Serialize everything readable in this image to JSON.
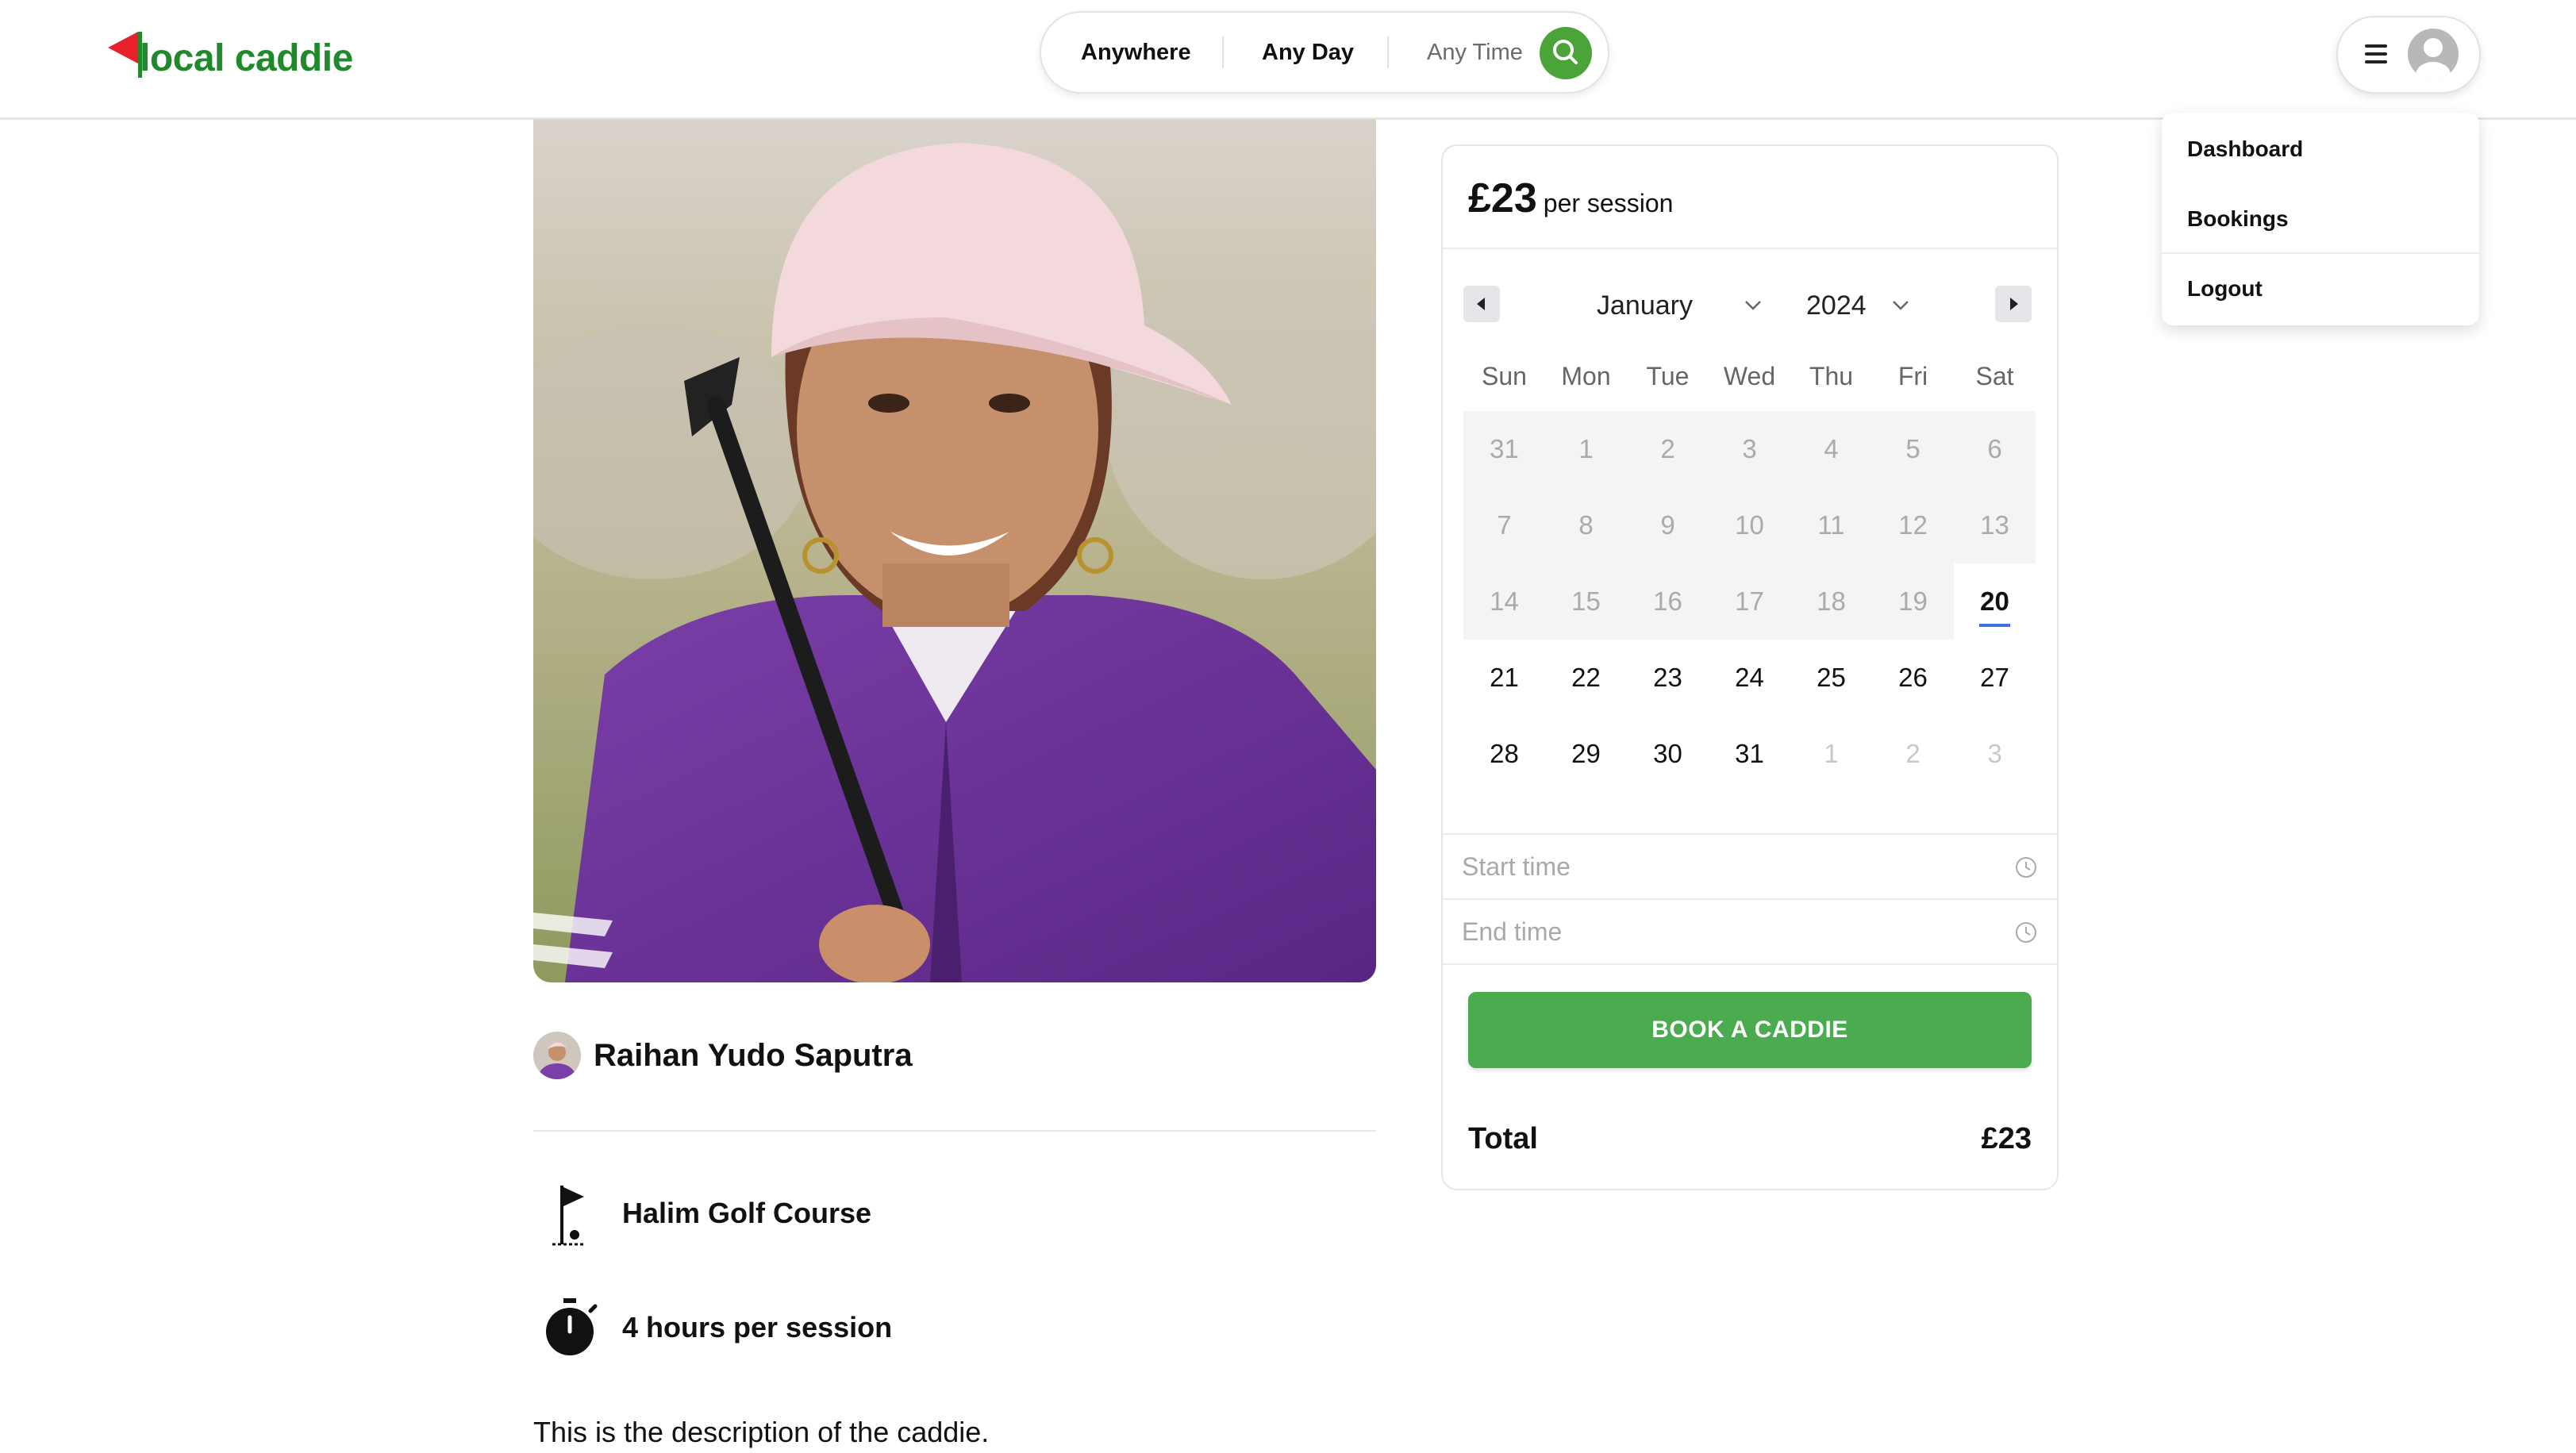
{
  "header": {
    "logo_text": "local caddie",
    "search": {
      "location": "Anywhere",
      "day": "Any Day",
      "time": "Any Time"
    }
  },
  "user_menu": {
    "items": [
      {
        "label": "Dashboard"
      },
      {
        "label": "Bookings"
      },
      {
        "label": "Logout"
      }
    ]
  },
  "caddie": {
    "name": "Raihan Yudo Saputra",
    "course": "Halim Golf Course",
    "duration": "4 hours per session",
    "description": "This is the description of the caddie."
  },
  "booking": {
    "price": "£23",
    "price_unit": "per session",
    "calendar": {
      "month": "January",
      "year": "2024",
      "weekdays": [
        "Sun",
        "Mon",
        "Tue",
        "Wed",
        "Thu",
        "Fri",
        "Sat"
      ],
      "weeks": [
        [
          "31",
          "1",
          "2",
          "3",
          "4",
          "5",
          "6"
        ],
        [
          "7",
          "8",
          "9",
          "10",
          "11",
          "12",
          "13"
        ],
        [
          "14",
          "15",
          "16",
          "17",
          "18",
          "19",
          "20"
        ],
        [
          "21",
          "22",
          "23",
          "24",
          "25",
          "26",
          "27"
        ],
        [
          "28",
          "29",
          "30",
          "31",
          "1",
          "2",
          "3"
        ]
      ],
      "today": "20"
    },
    "start_time_placeholder": "Start time",
    "end_time_placeholder": "End time",
    "book_button": "BOOK A CADDIE",
    "total_label": "Total",
    "total_value": "£23"
  },
  "colors": {
    "brand_green": "#1f8a2c",
    "button_green": "#4bab4f",
    "flag_red": "#e8202a",
    "today_underline": "#3f6fe0"
  },
  "icons": [
    "search-icon",
    "menu-icon",
    "user-avatar-icon",
    "golf-flag-icon",
    "stopwatch-icon",
    "clock-icon",
    "chevron-down-icon",
    "triangle-left-icon",
    "triangle-right-icon"
  ]
}
